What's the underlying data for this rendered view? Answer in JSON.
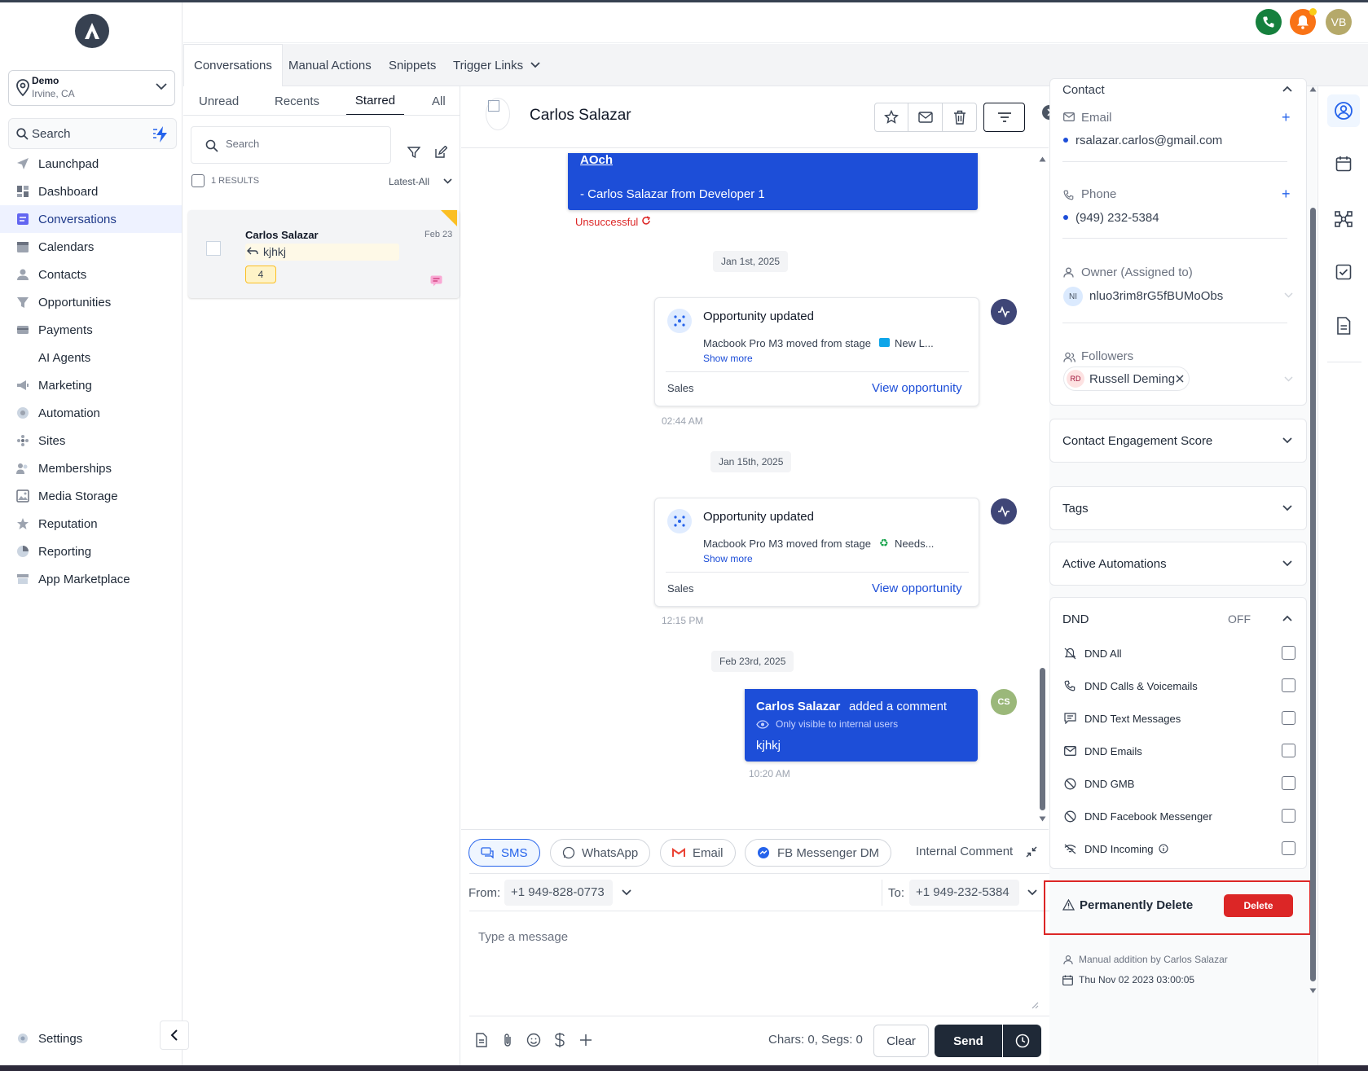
{
  "app": {
    "location": {
      "name": "Demo",
      "city": "Irvine, CA"
    },
    "sidebar_search": "Search",
    "nav": [
      {
        "label": "Launchpad",
        "icon": "send-icon"
      },
      {
        "label": "Dashboard",
        "icon": "dashboard-icon"
      },
      {
        "label": "Conversations",
        "icon": "chat-icon",
        "active": true
      },
      {
        "label": "Calendars",
        "icon": "calendar-icon"
      },
      {
        "label": "Contacts",
        "icon": "user-icon"
      },
      {
        "label": "Opportunities",
        "icon": "funnel-icon"
      },
      {
        "label": "Payments",
        "icon": "card-icon"
      },
      {
        "label": "AI Agents",
        "icon": ""
      },
      {
        "label": "Marketing",
        "icon": "megaphone-icon"
      },
      {
        "label": "Automation",
        "icon": "automation-icon"
      },
      {
        "label": "Sites",
        "icon": "sites-icon"
      },
      {
        "label": "Memberships",
        "icon": "memberships-icon"
      },
      {
        "label": "Media Storage",
        "icon": "image-icon"
      },
      {
        "label": "Reputation",
        "icon": "star-icon"
      },
      {
        "label": "Reporting",
        "icon": "pie-icon"
      },
      {
        "label": "App Marketplace",
        "icon": "store-icon"
      }
    ],
    "settings": "Settings",
    "user_initials": "VB"
  },
  "tabs": [
    "Conversations",
    "Manual Actions",
    "Snippets",
    "Trigger Links"
  ],
  "list": {
    "subtabs": [
      "Unread",
      "Recents",
      "Starred",
      "All"
    ],
    "search_placeholder": "Search",
    "results": "1 RESULTS",
    "sort": "Latest-All",
    "item": {
      "name": "Carlos Salazar",
      "date": "Feb 23",
      "preview": "kjhkj",
      "count": "4"
    }
  },
  "chat": {
    "contact_name": "Carlos Salazar",
    "top_bubble": {
      "link": "AOch",
      "text": "- Carlos Salazar from Developer 1",
      "status": "Unsuccessful"
    },
    "dates": [
      "Jan 1st, 2025",
      "Jan 15th, 2025",
      "Feb 23rd, 2025"
    ],
    "activities": [
      {
        "title": "Opportunity updated",
        "body": "Macbook Pro M3 moved from stage",
        "stage": "New L...",
        "more": "Show more",
        "pipeline": "Sales",
        "link": "View opportunity",
        "time": "02:44 AM"
      },
      {
        "title": "Opportunity updated",
        "body": "Macbook Pro M3 moved from stage",
        "stage": "Needs...",
        "more": "Show more",
        "pipeline": "Sales",
        "link": "View opportunity",
        "time": "12:15 PM"
      }
    ],
    "comment": {
      "author": "Carlos Salazar",
      "action": "added a comment",
      "visibility": "Only visible to internal users",
      "text": "kjhkj",
      "time": "10:20 AM",
      "initials": "CS"
    }
  },
  "composer": {
    "channels": [
      "SMS",
      "WhatsApp",
      "Email",
      "FB Messenger DM",
      "Internal Comment"
    ],
    "from_label": "From:",
    "from_value": "+1 949-828-0773",
    "to_label": "To:",
    "to_value": "+1 949-232-5384",
    "placeholder": "Type a message",
    "counter": "Chars: 0, Segs: 0",
    "clear": "Clear",
    "send": "Send"
  },
  "contact_panel": {
    "section": "Contact",
    "email_label": "Email",
    "email": "rsalazar.carlos@gmail.com",
    "phone_label": "Phone",
    "phone": "(949) 232-5384",
    "owner_label": "Owner (Assigned to)",
    "owner_initials": "NI",
    "owner": "nluo3rim8rG5fBUMoObs",
    "followers_label": "Followers",
    "follower_initials": "RD",
    "follower": "Russell Deming",
    "engagement": "Contact Engagement Score",
    "tags": "Tags",
    "automations": "Active Automations",
    "dnd": "DND",
    "dnd_state": "OFF",
    "dnd_items": [
      "DND All",
      "DND Calls & Voicemails",
      "DND Text Messages",
      "DND Emails",
      "DND GMB",
      "DND Facebook Messenger",
      "DND Incoming"
    ],
    "delete_label": "Permanently Delete",
    "delete_button": "Delete",
    "added_by": "Manual addition by Carlos Salazar",
    "added_on": "Thu Nov 02 2023 03:00:05"
  }
}
